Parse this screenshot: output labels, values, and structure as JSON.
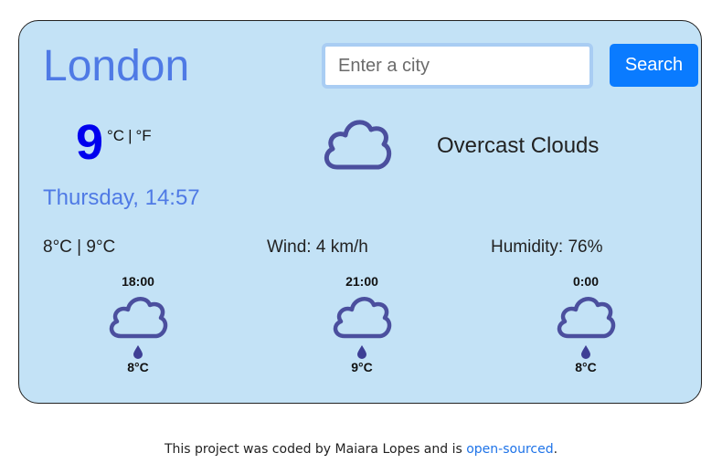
{
  "weather": {
    "city": "London",
    "search_placeholder": "Enter a city",
    "search_label": "Search",
    "temperature": "9",
    "unit_c": "°C",
    "unit_sep": "|",
    "unit_f": "°F",
    "description": "Overcast Clouds",
    "date": "Thursday, 14:57",
    "min_max": "8°C | 9°C",
    "wind": "Wind: 4 km/h",
    "humidity": "Humidity: 76%",
    "main_icon": "cloud-icon",
    "forecast": [
      {
        "time": "18:00",
        "temp": "8°C",
        "icon": "rain-cloud-icon"
      },
      {
        "time": "21:00",
        "temp": "9°C",
        "icon": "rain-cloud-icon"
      },
      {
        "time": "0:00",
        "temp": "8°C",
        "icon": "rain-cloud-icon"
      }
    ]
  },
  "footer": {
    "text": "This project was coded by Maiara Lopes and is ",
    "link": "open-sourced",
    "end": "."
  },
  "colors": {
    "card_bg": "#c3e2f6",
    "accent": "#4f7ae5",
    "button": "#0a7bff",
    "temp": "#0000ee",
    "icon": "#3e3f95"
  }
}
